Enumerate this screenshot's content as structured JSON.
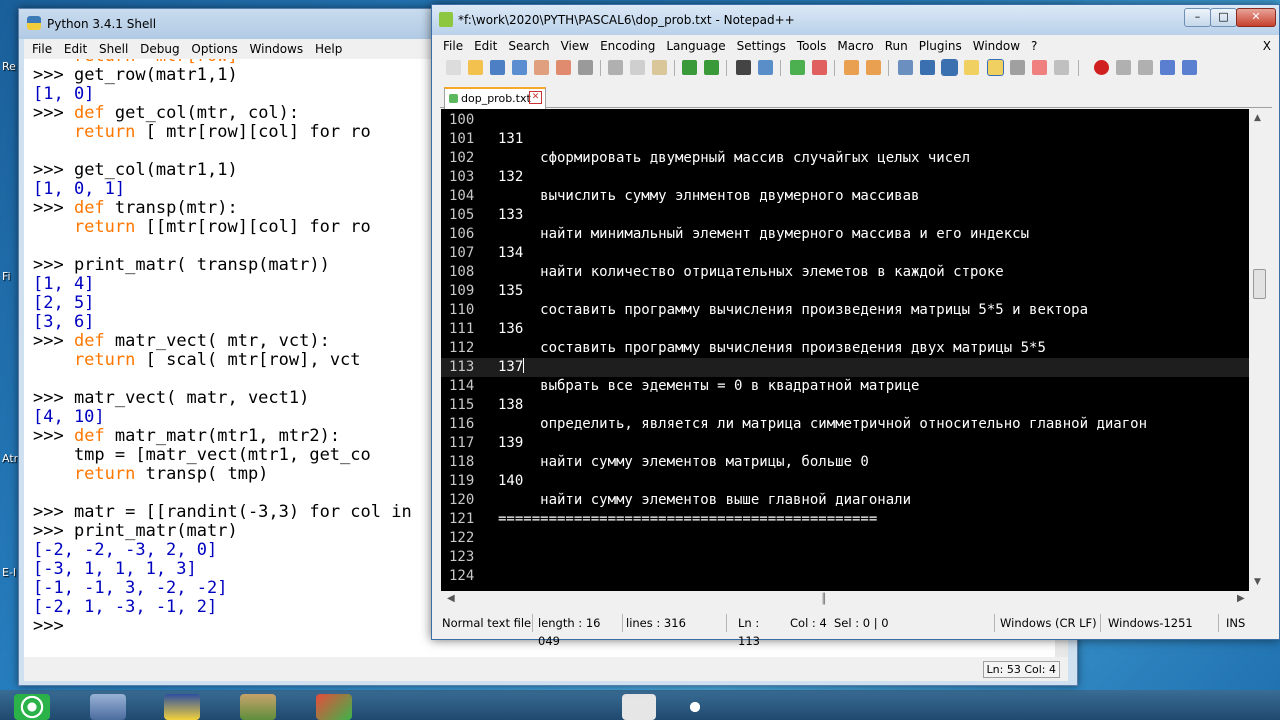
{
  "desktop": {
    "labels": [
      "Re",
      "Fi",
      "Atr",
      "E-I"
    ]
  },
  "python_shell": {
    "title": "Python 3.4.1 Shell",
    "menu": [
      "File",
      "Edit",
      "Shell",
      "Debug",
      "Options",
      "Windows",
      "Help"
    ],
    "lines": [
      {
        "p": "",
        "t": "    return  mtr[row]",
        "cls": "kw-line"
      },
      {
        "p": ">>> ",
        "t": "get_row(matr1,1)"
      },
      {
        "p": "",
        "t": "[1, 0]",
        "cls": "out"
      },
      {
        "p": ">>> ",
        "kw": "def ",
        "t": "get_col(mtr, col):"
      },
      {
        "p": "",
        "kw": "    return ",
        "t": "[ mtr[row][col] for ro"
      },
      {
        "p": "",
        "t": ""
      },
      {
        "p": ">>> ",
        "t": "get_col(matr1,1)"
      },
      {
        "p": "",
        "t": "[1, 0, 1]",
        "cls": "out"
      },
      {
        "p": ">>> ",
        "kw": "def ",
        "t": "transp(mtr):"
      },
      {
        "p": "",
        "kw": "    return ",
        "t": "[[mtr[row][col] for ro"
      },
      {
        "p": "",
        "t": ""
      },
      {
        "p": ">>> ",
        "t": "print_matr( transp(matr))"
      },
      {
        "p": "",
        "t": "[1, 4]",
        "cls": "out"
      },
      {
        "p": "",
        "t": "[2, 5]",
        "cls": "out"
      },
      {
        "p": "",
        "t": "[3, 6]",
        "cls": "out"
      },
      {
        "p": ">>> ",
        "kw": "def ",
        "t": "matr_vect( mtr, vct):"
      },
      {
        "p": "",
        "kw": "    return ",
        "t": "[ scal( mtr[row], vct"
      },
      {
        "p": "",
        "t": ""
      },
      {
        "p": ">>> ",
        "t": "matr_vect( matr, vect1)"
      },
      {
        "p": "",
        "t": "[4, 10]",
        "cls": "out"
      },
      {
        "p": ">>> ",
        "kw": "def ",
        "t": "matr_matr(mtr1, mtr2):"
      },
      {
        "p": "",
        "t": "    tmp = [matr_vect(mtr1, get_co"
      },
      {
        "p": "",
        "kw": "    return ",
        "t": "transp( tmp)"
      },
      {
        "p": "",
        "t": ""
      },
      {
        "p": ">>> ",
        "t": "matr = [[randint(-3,3) for col in"
      },
      {
        "p": ">>> ",
        "t": "print_matr(matr)"
      },
      {
        "p": "",
        "t": "[-2, -2, -3, 2, 0]",
        "cls": "out"
      },
      {
        "p": "",
        "t": "[-3, 1, 1, 1, 3]",
        "cls": "out"
      },
      {
        "p": "",
        "t": "[-1, -1, 3, -2, -2]",
        "cls": "out"
      },
      {
        "p": "",
        "t": "[-2, 1, -3, -1, 2]",
        "cls": "out"
      },
      {
        "p": ">>> ",
        "t": ""
      }
    ],
    "status": "Ln: 53 Col: 4"
  },
  "notepad": {
    "title": "*f:\\work\\2020\\PYTH\\PASCAL6\\dop_prob.txt - Notepad++",
    "menu": [
      "File",
      "Edit",
      "Search",
      "View",
      "Encoding",
      "Language",
      "Settings",
      "Tools",
      "Macro",
      "Run",
      "Plugins",
      "Window",
      "?"
    ],
    "menu_close": "X",
    "tab": "dop_prob.txt",
    "lines": [
      {
        "n": "100",
        "t": ""
      },
      {
        "n": "101",
        "t": "131"
      },
      {
        "n": "102",
        "t": "     сформировать двумерный массив случайгых целых чисел"
      },
      {
        "n": "103",
        "t": "132"
      },
      {
        "n": "104",
        "t": "     вычислить сумму элнментов двумерного массивав"
      },
      {
        "n": "105",
        "t": "133"
      },
      {
        "n": "106",
        "t": "     найти минимальный элемент двумерного массива и его индексы"
      },
      {
        "n": "107",
        "t": "134"
      },
      {
        "n": "108",
        "t": "     найти количество отрицательных элеметов в каждой строке"
      },
      {
        "n": "109",
        "t": "135"
      },
      {
        "n": "110",
        "t": "     составить программу вычисления произведения матрицы 5*5 и вектора"
      },
      {
        "n": "111",
        "t": "136"
      },
      {
        "n": "112",
        "t": "     составить программу вычисления произведения двух матрицы 5*5"
      },
      {
        "n": "113",
        "t": "137",
        "current": true
      },
      {
        "n": "114",
        "t": "     выбрать все эдементы = 0 в квадратной матрице"
      },
      {
        "n": "115",
        "t": "138"
      },
      {
        "n": "116",
        "t": "     определить, является ли матрица симметричной относительно главной диагон"
      },
      {
        "n": "117",
        "t": "139"
      },
      {
        "n": "118",
        "t": "     найти сумму элементов матрицы, больше 0"
      },
      {
        "n": "119",
        "t": "140"
      },
      {
        "n": "120",
        "t": "     найти сумму элементов выше главной диагонали"
      },
      {
        "n": "121",
        "t": "============================================="
      },
      {
        "n": "122",
        "t": ""
      },
      {
        "n": "123",
        "t": ""
      },
      {
        "n": "124",
        "t": ""
      }
    ],
    "status": {
      "type": "Normal text file",
      "length": "length : 16 049",
      "lines": "lines : 316",
      "ln": "Ln : 113",
      "col": "Col : 4",
      "sel": "Sel : 0 | 0",
      "eol": "Windows (CR LF)",
      "enc": "Windows-1251",
      "ins": "INS"
    }
  }
}
